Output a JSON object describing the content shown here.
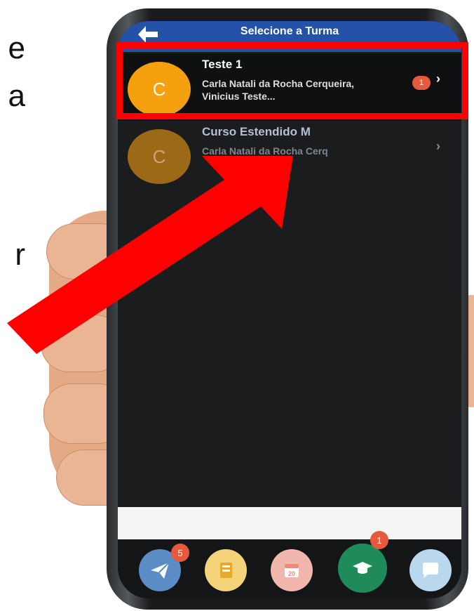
{
  "slide": {
    "fragments": [
      "e",
      "a",
      "r"
    ]
  },
  "app": {
    "header_title": "Selecione a Turma",
    "items": [
      {
        "avatar_letter": "C",
        "title": "Teste 1",
        "subtitle": "Carla Natali da Rocha Cerqueira, Vinicius Teste...",
        "badge": "1"
      },
      {
        "avatar_letter": "C",
        "title": "Curso Estendido M",
        "subtitle": "Carla Natali da Rocha Cerq"
      }
    ],
    "tabs": [
      {
        "icon": "send-icon",
        "badge": "5"
      },
      {
        "icon": "notebook-icon"
      },
      {
        "icon": "calendar-icon",
        "label": "20"
      },
      {
        "icon": "graduation-cap-icon",
        "badge": "1"
      },
      {
        "icon": "chat-bubble-icon"
      }
    ]
  },
  "colors": {
    "header": "#2352a8",
    "highlight": "#ff0000",
    "avatar_active": "#f5a10f",
    "badge": "#e55a3c"
  }
}
